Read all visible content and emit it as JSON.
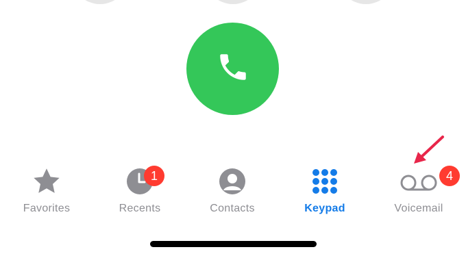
{
  "keypad": {
    "partial_keys": [
      "key-top-left",
      "key-top-center",
      "key-top-right"
    ],
    "call_button": {
      "icon": "phone-icon",
      "color": "#34c759"
    }
  },
  "tabs": [
    {
      "id": "favorites",
      "label": "Favorites",
      "icon": "star-icon",
      "active": false
    },
    {
      "id": "recents",
      "label": "Recents",
      "icon": "clock-icon",
      "badge": "1",
      "active": false
    },
    {
      "id": "contacts",
      "label": "Contacts",
      "icon": "person-circle-icon",
      "active": false
    },
    {
      "id": "keypad",
      "label": "Keypad",
      "icon": "keypad-grid-icon",
      "active": true
    },
    {
      "id": "voicemail",
      "label": "Voicemail",
      "icon": "voicemail-icon",
      "badge": "4",
      "active": false
    }
  ],
  "colors": {
    "active_tab": "#157ce8",
    "inactive_tab": "#8e8e93",
    "badge": "#ff3b30",
    "annotation_arrow": "#e8264a"
  }
}
